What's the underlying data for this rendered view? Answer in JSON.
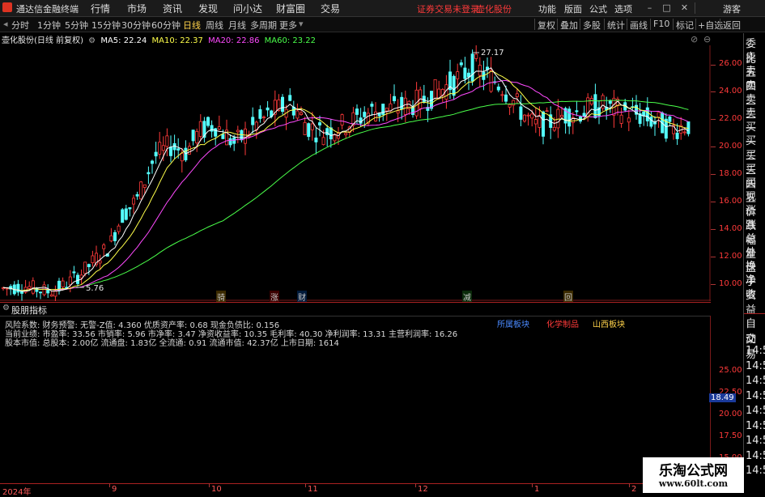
{
  "menubar": {
    "app_title": "通达信金融终端",
    "menu": [
      "行情",
      "市场",
      "资讯",
      "发现",
      "问小达",
      "财富圈",
      "交易"
    ],
    "warning": "证券交易未登录",
    "stock_name": "壶化股份",
    "right": [
      "功能",
      "版面",
      "公式",
      "选项"
    ],
    "user": "游客"
  },
  "toolbar": {
    "periods": [
      "分时",
      "1分钟",
      "5分钟",
      "15分钟",
      "30分钟",
      "60分钟",
      "日线",
      "周线",
      "月线",
      "多周期",
      "更多"
    ],
    "active_period": "日线",
    "right_items": [
      "复权",
      "叠加",
      "多股",
      "统计",
      "画线",
      "F10",
      "标记",
      "+自选",
      "返回"
    ]
  },
  "chart": {
    "title": "壶化股份(日线 前复权)",
    "ma": [
      {
        "label": "MA5: 22.24",
        "color": "#ffffff"
      },
      {
        "label": "MA10: 22.37",
        "color": "#ffff4a"
      },
      {
        "label": "MA20: 22.86",
        "color": "#ff4aff"
      },
      {
        "label": "MA60: 23.22",
        "color": "#4aff4a"
      }
    ],
    "high_label": "27.17",
    "low_label": "5.76",
    "price_ticks": [
      "26.00",
      "24.00",
      "22.00",
      "20.00",
      "18.00",
      "16.00",
      "14.00",
      "12.00",
      "10.00"
    ],
    "event_markers": [
      {
        "text": "骑",
        "color": "#e0a040"
      },
      {
        "text": "涨",
        "color": "#e04040"
      },
      {
        "text": "财",
        "color": "#4a8aff"
      },
      {
        "text": "减",
        "color": "#40c040"
      },
      {
        "text": "回",
        "color": "#e0a040"
      }
    ]
  },
  "indicator": {
    "name": "股朋指标",
    "lines": [
      "风险系数: 财务预警: 无警-Z值: 4.360 优质资产率: 0.68 现金负债比: 0.156",
      "当前业绩: 市盈率: 33.56 市销率: 5.96 市净率: 3.47 净资收益率: 10.35 毛利率: 40.30 净利润率: 13.31 主营利润率: 16.26",
      "股本市值: 总股本: 2.00亿 流通盘: 1.83亿 全流通: 0.91 流通市值: 42.37亿 上市日期: 1614"
    ],
    "sector_tags": [
      {
        "text": "所属板块",
        "color": "#4a8aff"
      },
      {
        "text": "化学制品",
        "color": "#ff3a3a"
      },
      {
        "text": "山西板块",
        "color": "#ffd24a"
      }
    ],
    "axis_ticks": [
      "25.00",
      "22.50",
      "20.00",
      "17.50",
      "15.00"
    ],
    "current_value": "18.49"
  },
  "xaxis": {
    "labels": [
      "2024年",
      "9",
      "10",
      "11",
      "12",
      "1",
      "2"
    ]
  },
  "right_panel": {
    "labels": [
      "委比",
      "卖五",
      "卖四",
      "卖三",
      "卖二",
      "卖一",
      "买一",
      "买二",
      "买三",
      "买四",
      "买五",
      "现价",
      "涨跌",
      "涨幅",
      "总量",
      "外盘",
      "换手",
      "净资",
      "收益"
    ],
    "lower_labels": [
      "自动",
      "交易",
      "14:5",
      "14:5",
      "14:5",
      "14:5",
      "14:5",
      "14:5",
      "14:5",
      "14:5",
      "14:5"
    ]
  },
  "watermark": {
    "line1": "乐淘公式网",
    "line2": "www.60lt.com"
  },
  "colors": {
    "up": "#ff3a3a",
    "down": "#54ffff",
    "ma5": "#ffffff",
    "ma10": "#ffff4a",
    "ma20": "#ff4aff",
    "ma60": "#4aff4a"
  }
}
